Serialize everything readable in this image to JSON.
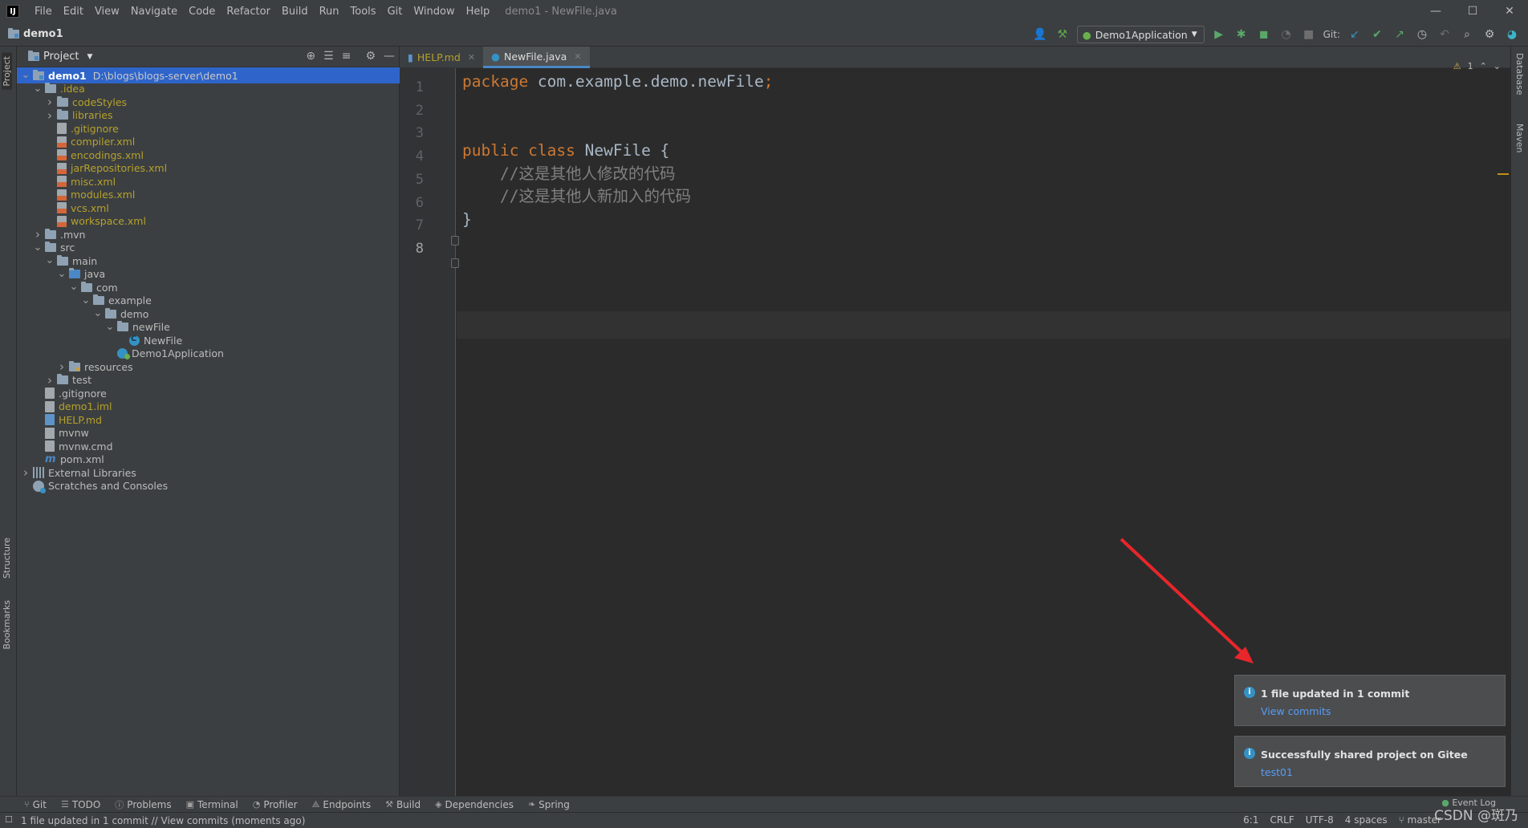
{
  "window": {
    "logo": "IJ",
    "title": "demo1 - NewFile.java",
    "menu": [
      "File",
      "Edit",
      "View",
      "Navigate",
      "Code",
      "Refactor",
      "Build",
      "Run",
      "Tools",
      "Git",
      "Window",
      "Help"
    ],
    "controls": {
      "minimize": "—",
      "maximize": "☐",
      "close": "✕"
    }
  },
  "navbar": {
    "project": "demo1",
    "run_config": "Demo1Application",
    "git_label": "Git:"
  },
  "left_strip": {
    "project": "Project",
    "structure": "Structure",
    "bookmarks": "Bookmarks"
  },
  "right_strip": {
    "database": "Database",
    "maven": "Maven"
  },
  "project_panel": {
    "title": "Project",
    "tree": [
      {
        "label": "demo1",
        "hint": "D:\\blogs\\blogs-server\\demo1",
        "depth": 0,
        "arrow": "v",
        "icon": "module",
        "style": "bold",
        "selected": true
      },
      {
        "label": ".idea",
        "depth": 1,
        "arrow": "v",
        "icon": "folder",
        "style": "ignored"
      },
      {
        "label": "codeStyles",
        "depth": 2,
        "arrow": ">",
        "icon": "folder",
        "style": "ignored"
      },
      {
        "label": "libraries",
        "depth": 2,
        "arrow": ">",
        "icon": "folder",
        "style": "ignored"
      },
      {
        "label": ".gitignore",
        "depth": 2,
        "arrow": "",
        "icon": "plain",
        "style": "ignored"
      },
      {
        "label": "compiler.xml",
        "depth": 2,
        "arrow": "",
        "icon": "xml",
        "style": "ignored"
      },
      {
        "label": "encodings.xml",
        "depth": 2,
        "arrow": "",
        "icon": "xml",
        "style": "ignored"
      },
      {
        "label": "jarRepositories.xml",
        "depth": 2,
        "arrow": "",
        "icon": "xml",
        "style": "ignored"
      },
      {
        "label": "misc.xml",
        "depth": 2,
        "arrow": "",
        "icon": "xml",
        "style": "ignored"
      },
      {
        "label": "modules.xml",
        "depth": 2,
        "arrow": "",
        "icon": "xml",
        "style": "ignored"
      },
      {
        "label": "vcs.xml",
        "depth": 2,
        "arrow": "",
        "icon": "xml",
        "style": "ignored"
      },
      {
        "label": "workspace.xml",
        "depth": 2,
        "arrow": "",
        "icon": "xml",
        "style": "ignored"
      },
      {
        "label": ".mvn",
        "depth": 1,
        "arrow": ">",
        "icon": "folder",
        "style": "normal"
      },
      {
        "label": "src",
        "depth": 1,
        "arrow": "v",
        "icon": "folder",
        "style": "normal"
      },
      {
        "label": "main",
        "depth": 2,
        "arrow": "v",
        "icon": "folder",
        "style": "normal"
      },
      {
        "label": "java",
        "depth": 3,
        "arrow": "v",
        "icon": "srcfolder",
        "style": "normal"
      },
      {
        "label": "com",
        "depth": 4,
        "arrow": "v",
        "icon": "package",
        "style": "normal"
      },
      {
        "label": "example",
        "depth": 5,
        "arrow": "v",
        "icon": "package",
        "style": "normal"
      },
      {
        "label": "demo",
        "depth": 6,
        "arrow": "v",
        "icon": "package",
        "style": "normal"
      },
      {
        "label": "newFile",
        "depth": 7,
        "arrow": "v",
        "icon": "package",
        "style": "normal"
      },
      {
        "label": "NewFile",
        "depth": 8,
        "arrow": "",
        "icon": "class",
        "style": "normal"
      },
      {
        "label": "Demo1Application",
        "depth": 7,
        "arrow": "",
        "icon": "spring",
        "style": "normal"
      },
      {
        "label": "resources",
        "depth": 3,
        "arrow": ">",
        "icon": "resfolder",
        "style": "normal"
      },
      {
        "label": "test",
        "depth": 2,
        "arrow": ">",
        "icon": "folder",
        "style": "normal"
      },
      {
        "label": ".gitignore",
        "depth": 1,
        "arrow": "",
        "icon": "plain",
        "style": "normal"
      },
      {
        "label": "demo1.iml",
        "depth": 1,
        "arrow": "",
        "icon": "plain",
        "style": "ignored"
      },
      {
        "label": "HELP.md",
        "depth": 1,
        "arrow": "",
        "icon": "md",
        "style": "ignored"
      },
      {
        "label": "mvnw",
        "depth": 1,
        "arrow": "",
        "icon": "exec",
        "style": "normal"
      },
      {
        "label": "mvnw.cmd",
        "depth": 1,
        "arrow": "",
        "icon": "plain",
        "style": "normal"
      },
      {
        "label": "pom.xml",
        "depth": 1,
        "arrow": "",
        "icon": "maven",
        "style": "normal"
      },
      {
        "label": "External Libraries",
        "depth": 0,
        "arrow": ">",
        "icon": "libs",
        "style": "normal"
      },
      {
        "label": "Scratches and Consoles",
        "depth": 0,
        "arrow": "",
        "icon": "scratch",
        "style": "normal"
      }
    ]
  },
  "editor": {
    "tabs": [
      {
        "label": "HELP.md",
        "active": false
      },
      {
        "label": "NewFile.java",
        "active": true
      }
    ],
    "line_numbers": [
      "1",
      "2",
      "3",
      "4",
      "5",
      "6",
      "7",
      "8"
    ],
    "code": {
      "l1_kw": "package",
      "l1_rest": " com.example.demo.newFile",
      "l1_semi": ";",
      "l4_kw": "public class",
      "l4_cls": " NewFile",
      "l4_brace": " {",
      "l5": "    //这是其他人修改的代码",
      "l6": "    //这是其他人新加入的代码",
      "l7": "}"
    },
    "warning_count": "1"
  },
  "notifications": [
    {
      "title": "1 file updated in 1 commit",
      "link": "View commits"
    },
    {
      "title": "Successfully shared project on Gitee",
      "link": "test01"
    }
  ],
  "toolwindows": [
    "Git",
    "TODO",
    "Problems",
    "Terminal",
    "Profiler",
    "Endpoints",
    "Build",
    "Dependencies",
    "Spring"
  ],
  "event_log": "Event Log",
  "status": {
    "message": "1 file updated in 1 commit // View commits (moments ago)",
    "position": "6:1",
    "line_sep": "CRLF",
    "encoding": "UTF-8",
    "indent": "4 spaces",
    "branch": "master"
  },
  "watermark": "CSDN @斑乃"
}
